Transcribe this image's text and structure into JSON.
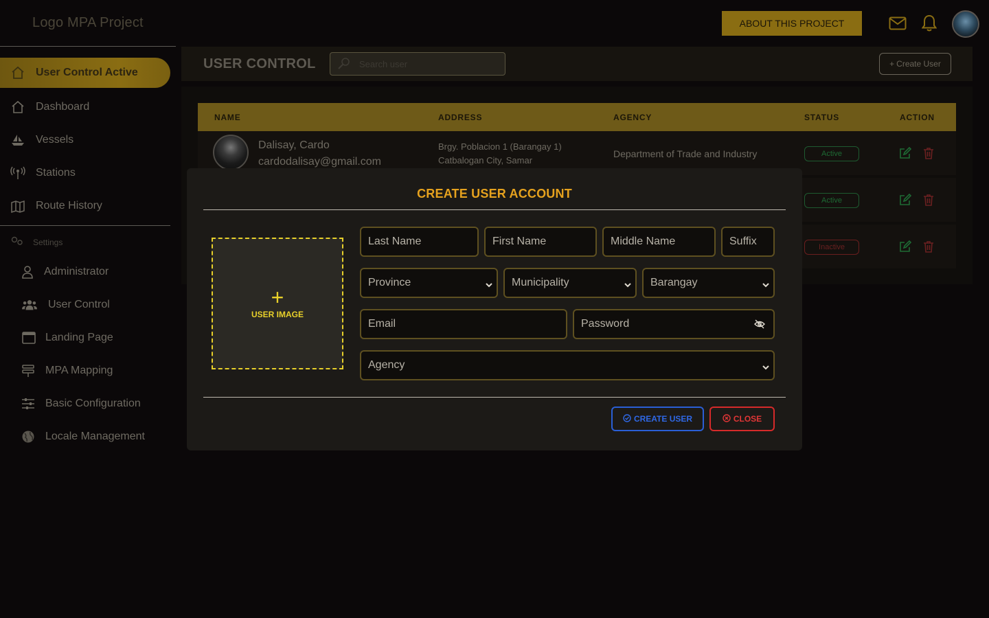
{
  "app": {
    "logo_text": "Logo MPA Project"
  },
  "header": {
    "about_label": "ABOUT THIS PROJECT",
    "mail_icon": "mail-icon",
    "bell_icon": "bell-icon"
  },
  "sidebar": {
    "items": [
      {
        "label": "User Control Active",
        "icon": "home-icon"
      },
      {
        "label": "Dashboard",
        "icon": "home-icon"
      },
      {
        "label": "Vessels",
        "icon": "ship-icon"
      },
      {
        "label": "Stations",
        "icon": "antenna-icon"
      },
      {
        "label": "Route History",
        "icon": "map-icon"
      }
    ],
    "settings_label": "Settings",
    "settings_items": [
      {
        "label": "Administrator",
        "icon": "user-icon"
      },
      {
        "label": "User Control",
        "icon": "users-icon"
      },
      {
        "label": "Landing Page",
        "icon": "window-icon"
      },
      {
        "label": "MPA Mapping",
        "icon": "layers-icon"
      },
      {
        "label": "Basic Configuration",
        "icon": "sliders-icon"
      },
      {
        "label": "Locale Management",
        "icon": "globe-icon"
      }
    ]
  },
  "page": {
    "title": "USER CONTROL",
    "search_placeholder": "Search user",
    "create_button": "Create User",
    "columns": [
      "NAME",
      "ADDRESS",
      "AGENCY",
      "STATUS",
      "ACTION"
    ],
    "rows": [
      {
        "name": "Dalisay, Cardo",
        "email": "cardodalisay@gmail.com",
        "address_line1": "Brgy. Poblacion 1 (Barangay 1)",
        "address_line2": "Catbalogan City, Samar",
        "agency": "Department of Trade and Industry",
        "status": "Active"
      },
      {
        "status": "Active"
      },
      {
        "status": "Inactive"
      }
    ]
  },
  "modal": {
    "title": "CREATE USER ACCOUNT",
    "upload_plus": "+",
    "upload_label": "USER IMAGE",
    "fields": {
      "last_name": "Last Name",
      "first_name": "First Name",
      "middle_name": "Middle Name",
      "suffix": "Suffix",
      "province": "Province",
      "municipality": "Municipality",
      "barangay": "Barangay",
      "email": "Email",
      "password": "Password",
      "agency": "Agency"
    },
    "create_label": "CREATE USER",
    "close_label": "CLOSE"
  },
  "colors": {
    "accent": "#8a6d12",
    "title": "#e6a21e",
    "upload_border": "#e8d02a",
    "create": "#2a5fd6",
    "close": "#d62a2a",
    "active": "#1e6a34",
    "inactive": "#6a2020"
  }
}
